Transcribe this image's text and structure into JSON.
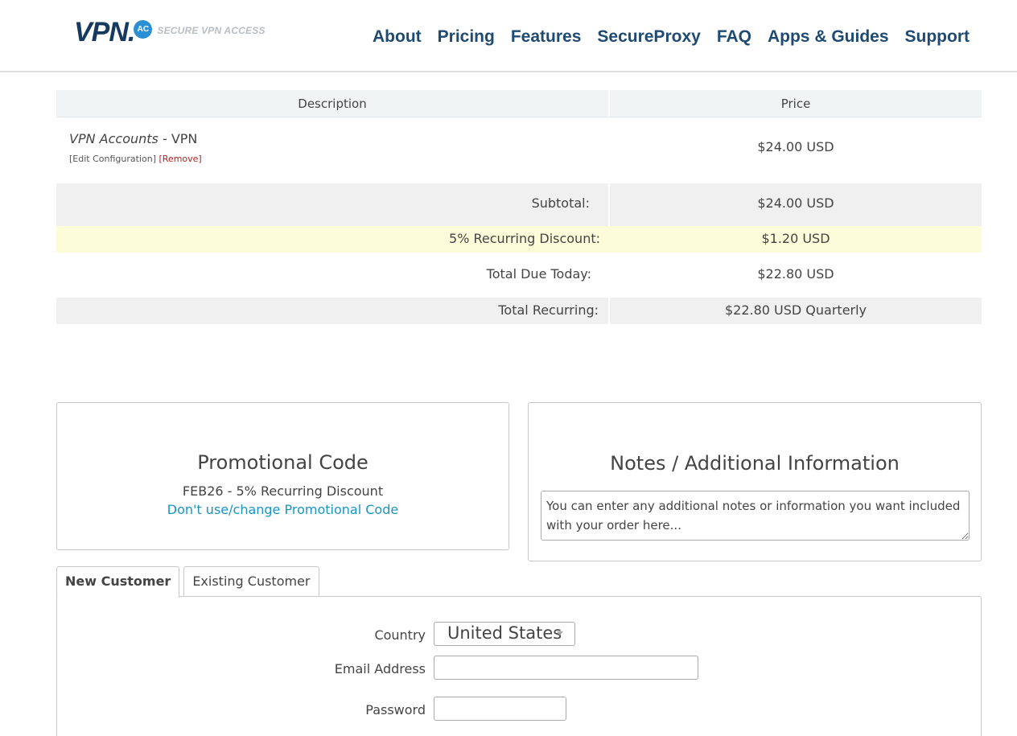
{
  "header": {
    "logo_text": "VPN.",
    "logo_badge": "AC",
    "logo_tagline": "SECURE VPN ACCESS",
    "nav": [
      "About",
      "Pricing",
      "Features",
      "SecureProxy",
      "FAQ",
      "Apps & Guides",
      "Support"
    ]
  },
  "cart": {
    "headers": {
      "description": "Description",
      "price": "Price"
    },
    "item": {
      "product": "VPN Accounts",
      "separator": " - ",
      "group": "VPN",
      "edit_link": "[Edit Configuration]",
      "remove_link": "[Remove]",
      "price": "$24.00 USD"
    },
    "totals": [
      {
        "label": "Subtotal:",
        "value": "$24.00 USD"
      },
      {
        "label": "5% Recurring Discount:",
        "value": "$1.20 USD"
      },
      {
        "label": "Total Due Today:",
        "value": "$22.80 USD"
      },
      {
        "label": "Total Recurring:",
        "value": "$22.80 USD Quarterly"
      }
    ]
  },
  "promo": {
    "title": "Promotional Code",
    "applied": "FEB26 - 5% Recurring Discount",
    "link": "Don't use/change Promotional Code"
  },
  "notes": {
    "title": "Notes / Additional Information",
    "placeholder": "You can enter any additional notes or information you want included with your order here..."
  },
  "tabs": [
    "New Customer",
    "Existing Customer"
  ],
  "form": {
    "country_label": "Country",
    "country_value": "United States",
    "email_label": "Email Address",
    "email_value": "",
    "password_label": "Password",
    "password_value": ""
  },
  "colors": {
    "nav": "#1f4a72",
    "logo": "#163a5f",
    "badge": "#2b8fd6",
    "link": "#1a94c4",
    "remove": "#b22222",
    "discount_row": "#fdfcd8",
    "shaded_row": "#f0f0f0"
  }
}
